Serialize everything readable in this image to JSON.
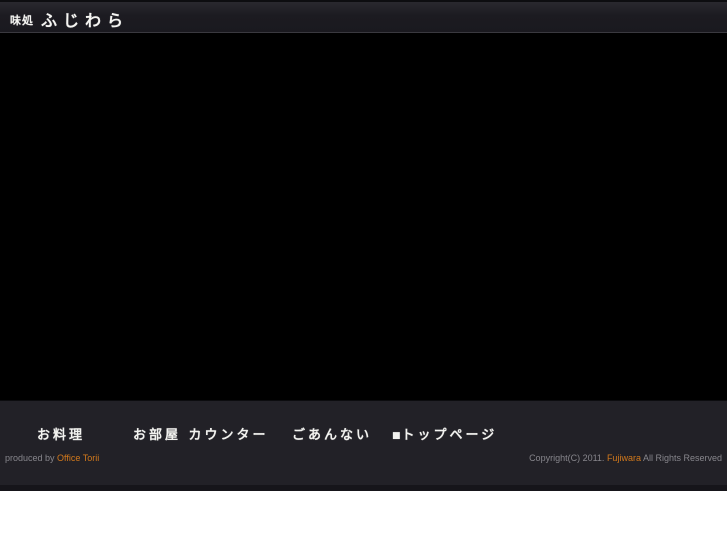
{
  "header": {
    "logo_prefix": "味処",
    "logo_name": "ふじわら"
  },
  "nav": {
    "items": [
      {
        "label": "お料理"
      },
      {
        "label": "お部屋 カウンター"
      },
      {
        "label": "ごあんない"
      },
      {
        "label": "トップページ",
        "marker": "■"
      }
    ]
  },
  "footer": {
    "produced_prefix": "produced by ",
    "produced_brand": "Office Torii",
    "copyright_prefix": "Copyright(C) 2011. ",
    "copyright_brand": "Fujiwara",
    "copyright_suffix": " All Rights Reserved"
  },
  "colors": {
    "accent_orange": "#d2791c",
    "header_bg": "#1c1b21",
    "bottombar_bg": "#222127",
    "main_visual_bg": "#000000",
    "page_bg": "#ffffff"
  }
}
